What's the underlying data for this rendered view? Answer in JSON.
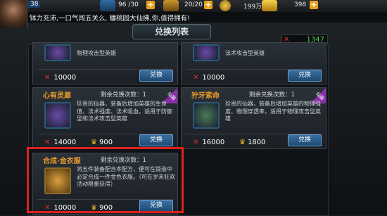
{
  "topbar": {
    "level": "38",
    "stamina": "96 /30",
    "energy": "20/20",
    "gold": "199万",
    "diamonds": "398"
  },
  "marquee": {
    "text": "钵力充沛,一口气闯五关么, 蟠桃园大仙拂,你,值得拥有!"
  },
  "panel": {
    "title": "兑换列表",
    "balance": "1347"
  },
  "cards": [
    {
      "name": "",
      "desc": "物理攻击型英雄",
      "price": "10000",
      "gold_price": "",
      "button": "兑换"
    },
    {
      "name": "",
      "desc": "法术攻击型英雄",
      "price": "10000",
      "gold_price": "",
      "button": "兑换"
    },
    {
      "name": "心有灵犀",
      "remain": "剩余兑换次数：1",
      "desc": "珍贵的仙器，装备后增加英雄的生命值、法术强度、法术吸血，适用于防御型和法术攻击型英雄",
      "price": "14000",
      "gold_price": "900",
      "button": "兑换",
      "ribbon": "仙器"
    },
    {
      "name": "狞牙索命",
      "remain": "剩余兑换次数：1",
      "desc": "珍贵的仙器，装备后增加英雄的物理强度、物理穿透率，适用于物理攻击型英雄",
      "price": "16000",
      "gold_price": "1800",
      "button": "兑换",
      "ribbon": "仙器"
    },
    {
      "name": "合成·金衣服",
      "remain": "剩余兑换次数：1",
      "desc": "将五件装备配合本配方，便可在锻造中必定合成一件金色衣服。（可在岁末狂欢活动限量获得）",
      "price": "10000",
      "gold_price": "900",
      "button": "兑换"
    }
  ]
}
